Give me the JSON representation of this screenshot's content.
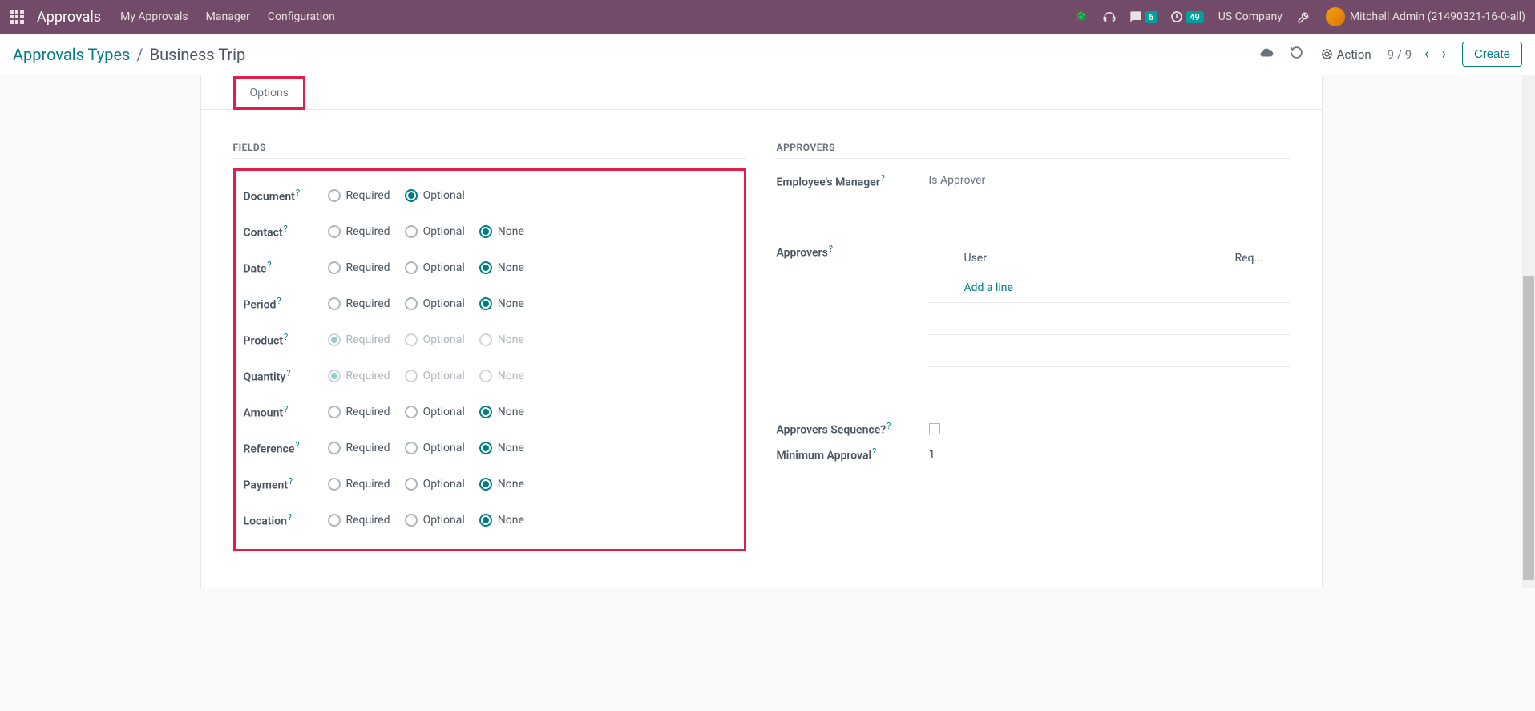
{
  "nav": {
    "app_title": "Approvals",
    "links": [
      "My Approvals",
      "Manager",
      "Configuration"
    ],
    "messages_count": "6",
    "activities_count": "49",
    "company": "US Company",
    "user": "Mitchell Admin (21490321-16-0-all)"
  },
  "control_panel": {
    "breadcrumb_parent": "Approvals Types",
    "breadcrumb_current": "Business Trip",
    "action_label": "Action",
    "pager": "9 / 9",
    "create_label": "Create"
  },
  "tabs": {
    "options": "Options"
  },
  "sections": {
    "fields": "FIELDS",
    "approvers": "APPROVERS"
  },
  "radio_labels": {
    "required": "Required",
    "optional": "Optional",
    "none": "None"
  },
  "fields": [
    {
      "label": "Document",
      "selected": "optional",
      "has_none": false,
      "disabled": false
    },
    {
      "label": "Contact",
      "selected": "none",
      "has_none": true,
      "disabled": false
    },
    {
      "label": "Date",
      "selected": "none",
      "has_none": true,
      "disabled": false
    },
    {
      "label": "Period",
      "selected": "none",
      "has_none": true,
      "disabled": false
    },
    {
      "label": "Product",
      "selected": "required",
      "has_none": true,
      "disabled": true
    },
    {
      "label": "Quantity",
      "selected": "required",
      "has_none": true,
      "disabled": true
    },
    {
      "label": "Amount",
      "selected": "none",
      "has_none": true,
      "disabled": false
    },
    {
      "label": "Reference",
      "selected": "none",
      "has_none": true,
      "disabled": false
    },
    {
      "label": "Payment",
      "selected": "none",
      "has_none": true,
      "disabled": false
    },
    {
      "label": "Location",
      "selected": "none",
      "has_none": true,
      "disabled": false
    }
  ],
  "approvers": {
    "employee_manager_label": "Employee's Manager",
    "employee_manager_value": "Is Approver",
    "approvers_label": "Approvers",
    "table_headers": {
      "user": "User",
      "required": "Req..."
    },
    "add_line": "Add a line",
    "sequence_label": "Approvers Sequence?",
    "min_approval_label": "Minimum Approval",
    "min_approval_value": "1"
  }
}
